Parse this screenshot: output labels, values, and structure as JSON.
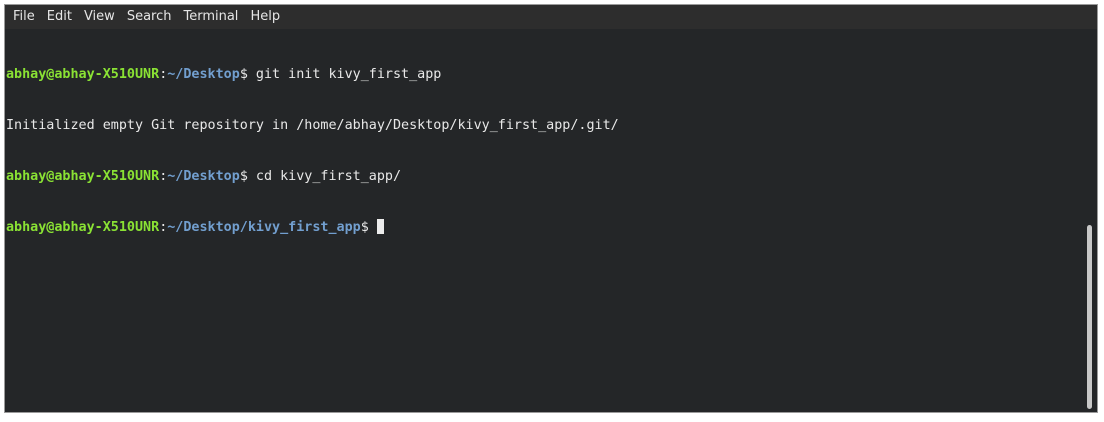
{
  "menu": {
    "items": [
      "File",
      "Edit",
      "View",
      "Search",
      "Terminal",
      "Help"
    ]
  },
  "terminal": {
    "lines": [
      {
        "user": "abhay@abhay-X510UNR",
        "sep": ":",
        "path": "~/Desktop",
        "prompt": "$",
        "command": " git init kivy_first_app"
      },
      {
        "output": "Initialized empty Git repository in /home/abhay/Desktop/kivy_first_app/.git/"
      },
      {
        "user": "abhay@abhay-X510UNR",
        "sep": ":",
        "path": "~/Desktop",
        "prompt": "$",
        "command": " cd kivy_first_app/"
      },
      {
        "user": "abhay@abhay-X510UNR",
        "sep": ":",
        "path": "~/Desktop/kivy_first_app",
        "prompt": "$",
        "command": ""
      }
    ]
  },
  "colors": {
    "background": "#242628",
    "user": "#8ae234",
    "path": "#729fcf",
    "text": "#e8e8e8"
  }
}
